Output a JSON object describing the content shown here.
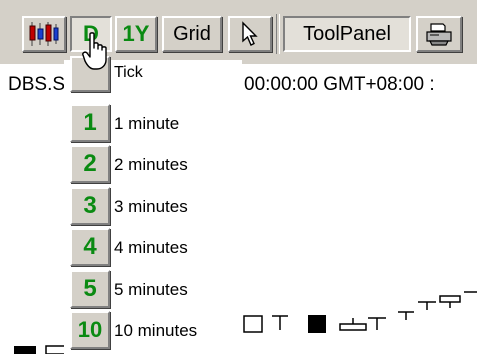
{
  "toolbar": {
    "chart_type_icon": "candlestick-chart-icon",
    "period_d_label": "D",
    "period_1y_label": "1Y",
    "grid_label": "Grid",
    "pointer_icon": "arrow-pointer-icon",
    "toolpanel_label": "ToolPanel",
    "print_icon": "printer-icon"
  },
  "status": {
    "symbol_text": "DBS.S",
    "time_text": "00:00:00 GMT+08:00 :"
  },
  "menu": {
    "items": [
      {
        "key": "",
        "label": "Tick"
      },
      {
        "key": "1",
        "label": "1 minute"
      },
      {
        "key": "2",
        "label": "2 minutes"
      },
      {
        "key": "3",
        "label": "3 minutes"
      },
      {
        "key": "4",
        "label": "4 minutes"
      },
      {
        "key": "5",
        "label": "5 minutes"
      },
      {
        "key": "10",
        "label": "10 minutes"
      }
    ]
  },
  "colors": {
    "toolbar_bg": "#d4d0c8",
    "accent_green": "#0a8a12"
  }
}
